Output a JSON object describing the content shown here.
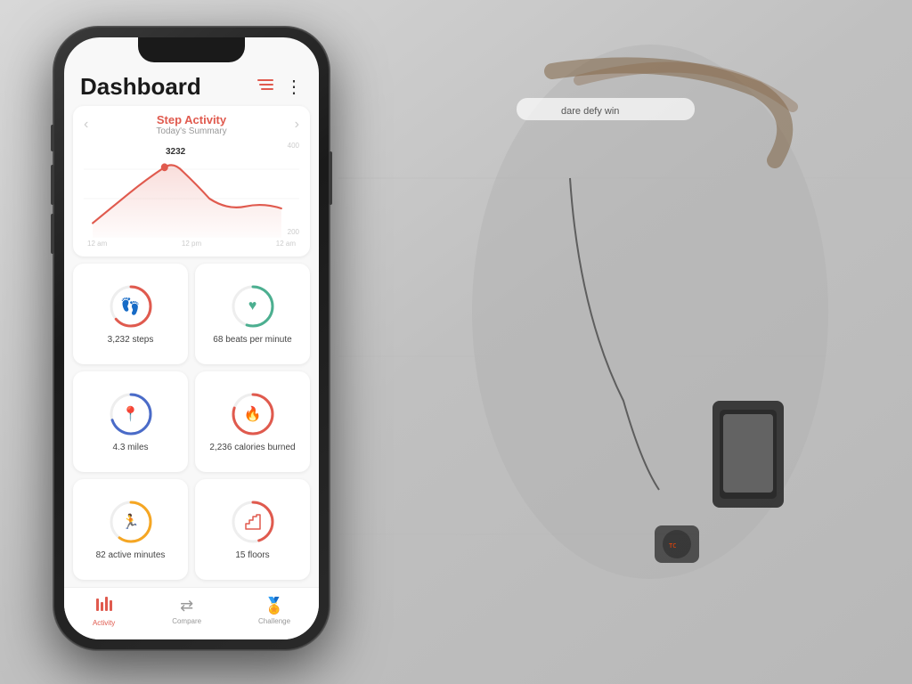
{
  "background": {
    "color": "#c8c8c8"
  },
  "app": {
    "header": {
      "title": "Dashboard",
      "filter_icon": "≡",
      "menu_icon": "⋮"
    },
    "chart": {
      "title": "Step Activity",
      "subtitle": "Today's Summary",
      "peak_value": "3232",
      "nav_left": "‹",
      "nav_right": "›",
      "y_labels": [
        "400",
        "200"
      ],
      "x_labels": [
        "12 am",
        "12 pm",
        "12 am"
      ]
    },
    "stats": [
      {
        "id": "steps",
        "value": "3,232 steps",
        "ring_color": "#e05a4e",
        "icon": "👣",
        "progress": 0.65
      },
      {
        "id": "heart",
        "value": "68 beats per minute",
        "ring_color": "#4caf90",
        "icon": "♥",
        "progress": 0.55
      },
      {
        "id": "miles",
        "value": "4.3 miles",
        "ring_color": "#4a6bc8",
        "icon": "📍",
        "progress": 0.7
      },
      {
        "id": "calories",
        "value": "2,236 calories burned",
        "ring_color": "#e05a4e",
        "icon": "🔥",
        "progress": 0.8
      },
      {
        "id": "active",
        "value": "82 active minutes",
        "ring_color": "#f5a623",
        "icon": "🏃",
        "progress": 0.6
      },
      {
        "id": "floors",
        "value": "15 floors",
        "ring_color": "#e05a4e",
        "icon": "🪜",
        "progress": 0.45
      }
    ],
    "nav": [
      {
        "id": "activity",
        "label": "Activity",
        "icon": "📊",
        "active": true
      },
      {
        "id": "compare",
        "label": "Compare",
        "icon": "⇄",
        "active": false
      },
      {
        "id": "challenge",
        "label": "Challenge",
        "icon": "🏅",
        "active": false
      }
    ]
  }
}
